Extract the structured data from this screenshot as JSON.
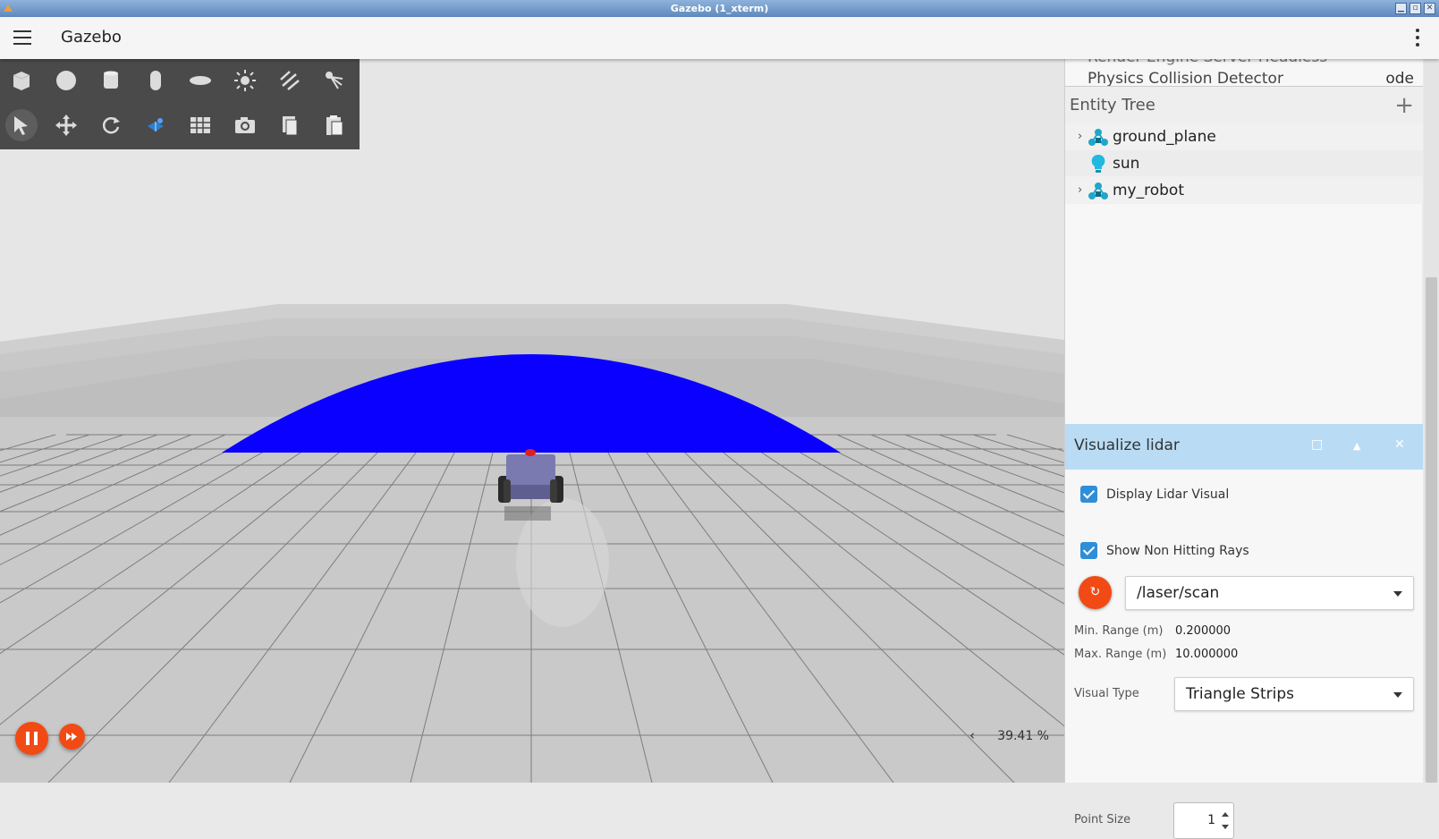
{
  "window": {
    "title": "Gazebo (1_xterm)",
    "buttons": [
      "minimize",
      "maximize",
      "close"
    ]
  },
  "appbar": {
    "title": "Gazebo"
  },
  "toolbar": {
    "row1": [
      "box-icon",
      "sphere-icon",
      "cylinder-icon",
      "capsule-icon",
      "ellipsoid-icon",
      "point-light-icon",
      "directional-light-icon",
      "spot-light-icon"
    ],
    "row2": [
      "select-icon",
      "translate-icon",
      "rotate-icon",
      "view-angle-icon",
      "grid-snap-icon",
      "screenshot-icon",
      "copy-icon",
      "paste-icon"
    ]
  },
  "playback": {
    "real_time_factor": "39.41 %"
  },
  "world_props": {
    "row1_label": "Render Engine Server Headless",
    "row2_label": "Physics Collision Detector",
    "row2_value": "ode"
  },
  "entity_tree": {
    "title": "Entity Tree",
    "add_label": "+",
    "items": [
      {
        "label": "ground_plane",
        "icon": "model-icon",
        "expandable": true
      },
      {
        "label": "sun",
        "icon": "light-icon",
        "expandable": false
      },
      {
        "label": "my_robot",
        "icon": "model-icon",
        "expandable": true
      }
    ]
  },
  "lidar": {
    "title": "Visualize lidar",
    "display_label": "Display Lidar Visual",
    "non_hitting_label": "Show Non Hitting Rays",
    "topic": "/laser/scan",
    "min_range_label": "Min. Range (m)",
    "min_range_value": "0.200000",
    "max_range_label": "Max. Range (m)",
    "max_range_value": "10.000000",
    "visual_type_label": "Visual Type",
    "visual_type_value": "Triangle Strips",
    "point_size_label": "Point Size",
    "point_size_value": "1"
  },
  "colors": {
    "accent": "#f24a14",
    "lidar_header": "#b9dcf4",
    "lidar_visual": "#0a00ff",
    "toolbar_bg": "#4a4a4a"
  }
}
